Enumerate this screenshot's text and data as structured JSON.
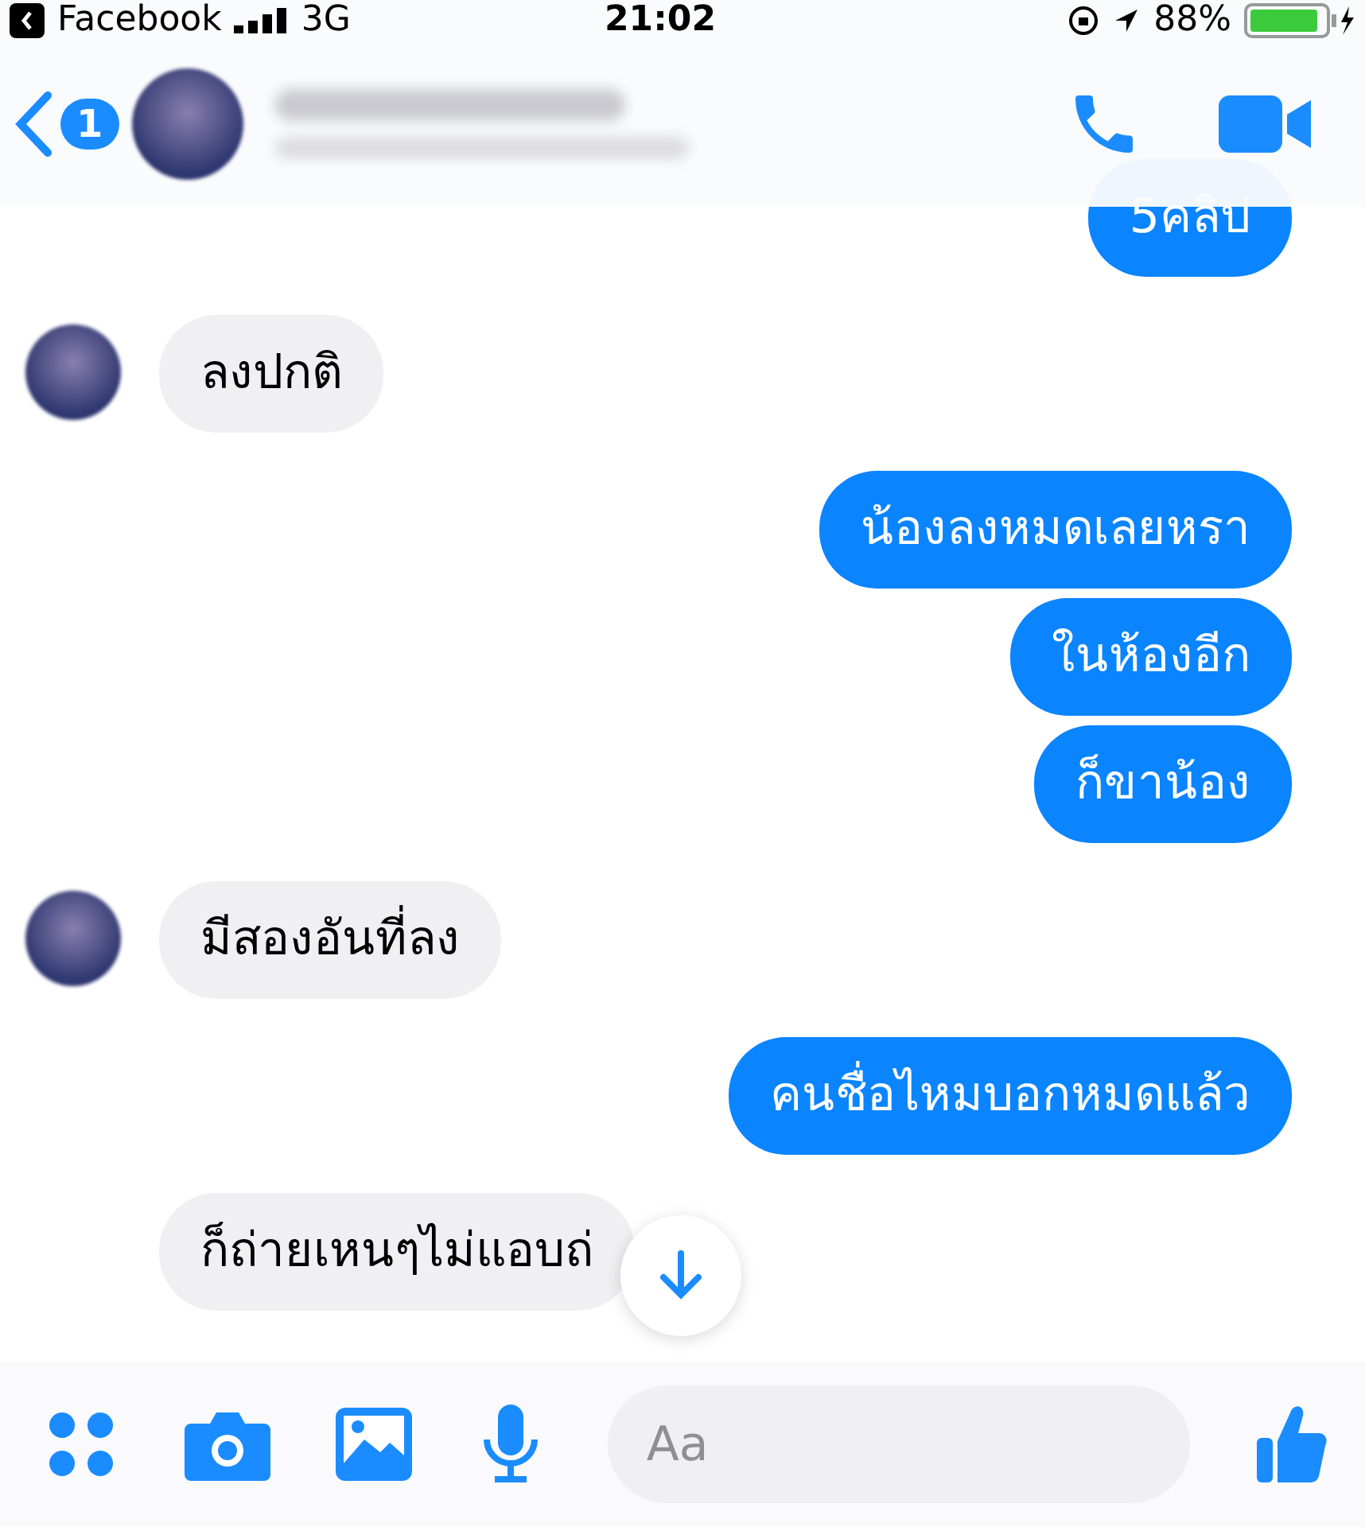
{
  "status_bar": {
    "carrier": "Facebook",
    "network": "3G",
    "time": "21:02",
    "battery": "88%"
  },
  "header": {
    "back_badge": "1"
  },
  "messages": [
    {
      "kind": "sent",
      "text": "5คลิป"
    },
    {
      "kind": "received",
      "text": "ลงปกติ",
      "avatar": true
    },
    {
      "kind": "sent",
      "text": "น้องลงหมดเลยหรา"
    },
    {
      "kind": "sent",
      "text": "ในห้องอีก"
    },
    {
      "kind": "sent",
      "text": "ก็ขาน้อง"
    },
    {
      "kind": "received",
      "text": "มีสองอันที่ลง",
      "avatar": true
    },
    {
      "kind": "sent",
      "text": "คนชื่อไหมบอกหมดแล้ว"
    },
    {
      "kind": "received",
      "text": "ก็ถ่ายเหนๆไม่แอบถ่",
      "avatar": false
    }
  ],
  "composer": {
    "placeholder": "Aa"
  }
}
